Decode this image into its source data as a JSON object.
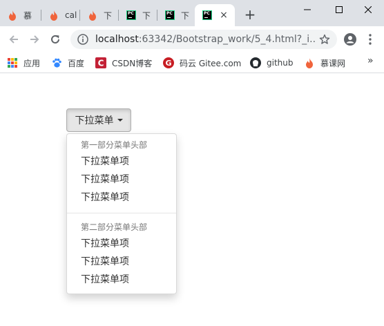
{
  "browser": {
    "tabs": [
      {
        "title": "慕",
        "icon": "flame-icon"
      },
      {
        "title": "cal",
        "icon": "flame-icon"
      },
      {
        "title": "下",
        "icon": "flame-icon"
      },
      {
        "title": "下",
        "icon": "pycharm-icon"
      },
      {
        "title": "下",
        "icon": "pycharm-icon"
      },
      {
        "title": "",
        "icon": "pycharm-icon",
        "active": true,
        "close": "×"
      }
    ],
    "new_tab": "+",
    "url_host": "localhost",
    "url_path": ":63342/Bootstrap_work/5_4.html?_i...",
    "bookmarks": [
      {
        "label": "应用",
        "icon": "apps-grid-icon"
      },
      {
        "label": "百度",
        "icon": "baidu-paw-icon"
      },
      {
        "label": "CSDN博客",
        "icon": "csdn-icon"
      },
      {
        "label": "码云 Gitee.com",
        "icon": "gitee-icon"
      },
      {
        "label": "github",
        "icon": "github-icon"
      },
      {
        "label": "慕课网",
        "icon": "flame-icon"
      }
    ],
    "bookmarks_more": "»",
    "colors": {
      "flame": "#f0643c",
      "csdn": "#c32136",
      "gitee": "#c71d23",
      "pycharm_green": "#21d789"
    }
  },
  "dropdown": {
    "button_label": "下拉菜单",
    "sections": [
      {
        "header": "第一部分菜单头部",
        "items": [
          "下拉菜单项",
          "下拉菜单项",
          "下拉菜单项"
        ]
      },
      {
        "header": "第二部分菜单头部",
        "items": [
          "下拉菜单项",
          "下拉菜单项",
          "下拉菜单项"
        ]
      }
    ]
  }
}
